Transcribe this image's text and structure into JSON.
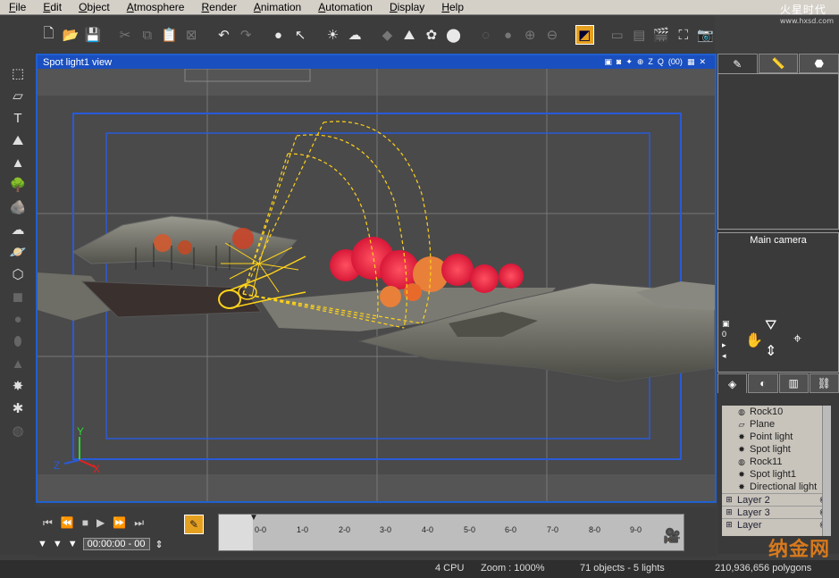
{
  "menu": [
    "File",
    "Edit",
    "Object",
    "Atmosphere",
    "Render",
    "Animation",
    "Automation",
    "Display",
    "Help"
  ],
  "logo": {
    "text": "火星时代",
    "url_text": "www.hxsd.com"
  },
  "viewport": {
    "title": "Spot light1 view",
    "tools": [
      "▣",
      "◙",
      "✦",
      "⊕",
      "Z",
      "Q",
      "(00)",
      "▦",
      "✕"
    ],
    "axis": {
      "x": "X",
      "y": "Y",
      "z": "Z"
    }
  },
  "right_panel": {
    "camera_label": "Main camera",
    "camera_counter": "0",
    "layers": [
      {
        "name": "Rock10",
        "icon": "rock"
      },
      {
        "name": "Plane",
        "icon": "plane"
      },
      {
        "name": "Point light",
        "icon": "light"
      },
      {
        "name": "Spot light",
        "icon": "light"
      },
      {
        "name": "Rock11",
        "icon": "rock"
      },
      {
        "name": "Spot light1",
        "icon": "light"
      },
      {
        "name": "Directional light",
        "icon": "light"
      }
    ],
    "groups": [
      "Layer 2",
      "Layer 3",
      "Layer"
    ]
  },
  "timeline": {
    "timecode": "00:00:00 - 00",
    "marks": [
      "0-0",
      "1-0",
      "2-0",
      "3-0",
      "4-0",
      "5-0",
      "6-0",
      "7-0",
      "8-0",
      "9-0"
    ]
  },
  "status": {
    "cpu": "4 CPU",
    "zoom": "Zoom : 1000%",
    "objects": "71 objects - 5 lights",
    "polygons": "210,936,656 polygons"
  },
  "watermark": "纳金网",
  "colors": {
    "accent_blue": "#2060d0",
    "active_orange": "#e6a020",
    "spot_yellow": "#ffd21a",
    "tree_red": "#e8323c"
  }
}
